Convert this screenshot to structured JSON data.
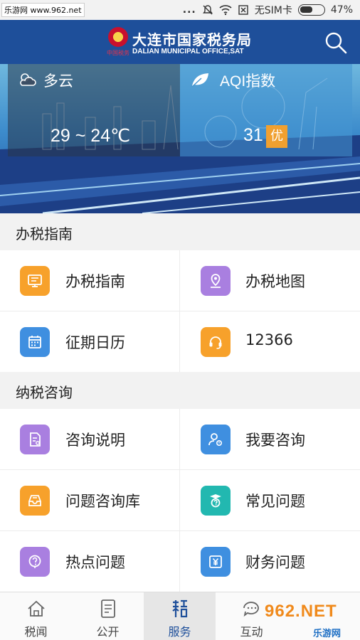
{
  "status_bar": {
    "watermark": "乐游网 www.962.net",
    "dots": "...",
    "sim": "无SIM卡",
    "battery": "47%"
  },
  "header": {
    "title": "大连市国家税务局",
    "subtitle": "DALIAN MUNICIPAL OFFICE,SAT",
    "emblem_text": "中国税务",
    "search_icon": "search-icon"
  },
  "weather": {
    "icon": "cloud-sun-icon",
    "condition": "多云",
    "temperature": "29 ~ 24℃"
  },
  "aqi": {
    "icon": "leaf-icon",
    "label": "AQI指数",
    "value": "31",
    "level": "优"
  },
  "sections": [
    {
      "title": "办税指南",
      "items": [
        {
          "label": "办税指南",
          "icon": "guide-icon",
          "color": "#f7a12b"
        },
        {
          "label": "办税地图",
          "icon": "map-pin-icon",
          "color": "#a97fe0"
        },
        {
          "label": "征期日历",
          "icon": "calendar-icon",
          "color": "#3f8fe0"
        },
        {
          "label": "12366",
          "icon": "headset-icon",
          "color": "#f7a12b"
        }
      ]
    },
    {
      "title": "纳税咨询",
      "items": [
        {
          "label": "咨询说明",
          "icon": "document-icon",
          "color": "#a97fe0"
        },
        {
          "label": "我要咨询",
          "icon": "user-consult-icon",
          "color": "#3f8fe0"
        },
        {
          "label": "问题咨询库",
          "icon": "inbox-icon",
          "color": "#f7a12b"
        },
        {
          "label": "常见问题",
          "icon": "faq-icon",
          "color": "#22b8b0"
        },
        {
          "label": "热点问题",
          "icon": "question-icon",
          "color": "#a97fe0"
        },
        {
          "label": "财务问题",
          "icon": "yuan-icon",
          "color": "#3f8fe0"
        }
      ]
    }
  ],
  "tabs": [
    {
      "label": "税闻",
      "icon": "home-icon",
      "active": false
    },
    {
      "label": "公开",
      "icon": "doc-list-icon",
      "active": false
    },
    {
      "label": "服务",
      "icon": "tax-service-icon",
      "active": true
    },
    {
      "label": "互动",
      "icon": "chat-icon",
      "active": false
    }
  ],
  "watermark_br": {
    "big": "962.NET",
    "small": "乐游网"
  },
  "colors": {
    "header_blue": "#1e4f9a",
    "aqi_badge": "#f0a030"
  }
}
